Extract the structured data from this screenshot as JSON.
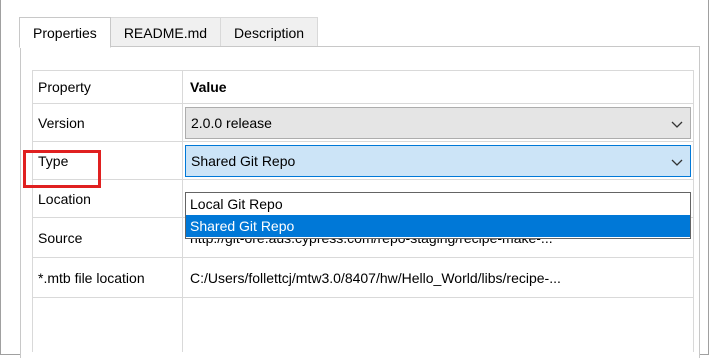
{
  "tabs": [
    {
      "label": "Properties",
      "active": true
    },
    {
      "label": "README.md",
      "active": false
    },
    {
      "label": "Description",
      "active": false
    }
  ],
  "grid": {
    "header": {
      "property": "Property",
      "value": "Value"
    },
    "rows": [
      {
        "label": "Version",
        "value": "2.0.0 release"
      },
      {
        "label": "Type",
        "value": "Shared Git Repo"
      },
      {
        "label": "Location",
        "value": ""
      },
      {
        "label": "Source",
        "value": "http://git-ore.aus.cypress.com/repo-staging/recipe-make-..."
      },
      {
        "label": "*.mtb file location",
        "value": "C:/Users/follettcj/mtw3.0/8407/hw/Hello_World/libs/recipe-..."
      }
    ]
  },
  "dropdown": {
    "options": [
      "Local Git Repo",
      "Shared Git Repo"
    ],
    "selected": "Shared Git Repo"
  },
  "colors": {
    "highlight": "#e02020",
    "selection": "#0078d7",
    "focused_combo": "#cce4f7"
  },
  "icons": {
    "combo_arrow": "chevron-down-icon"
  }
}
